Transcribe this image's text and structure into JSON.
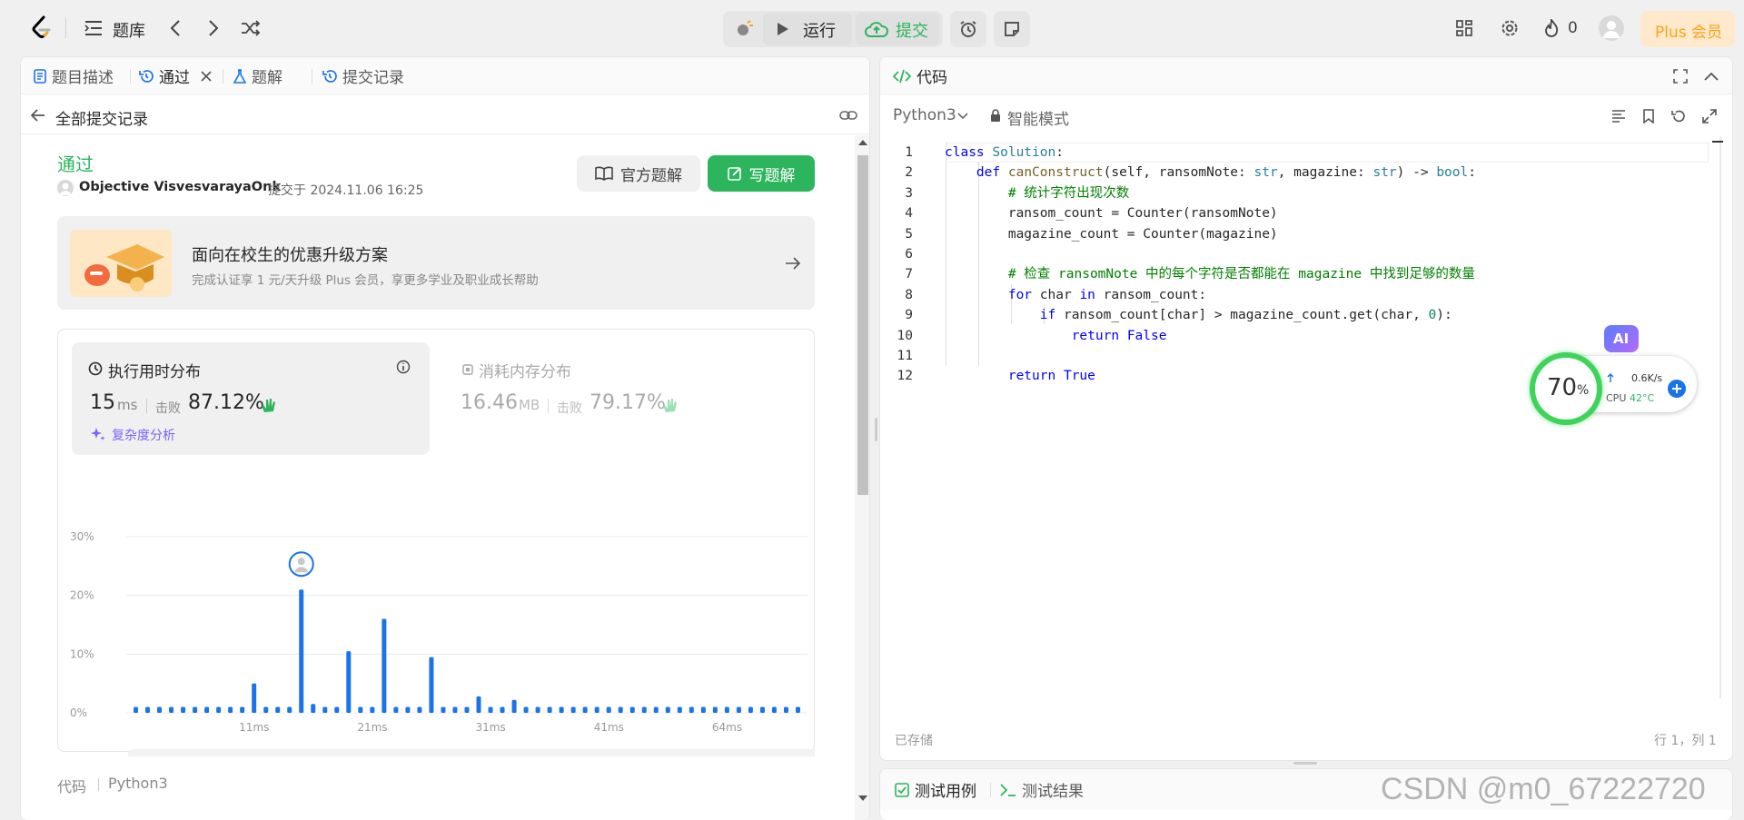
{
  "topbar": {
    "problems_label": "题库",
    "run_label": "运行",
    "submit_label": "提交",
    "streak_count": "0",
    "plus_label": "Plus 会员"
  },
  "left": {
    "tabs": [
      {
        "label": "题目描述"
      },
      {
        "label": "通过"
      },
      {
        "label": "题解"
      },
      {
        "label": "提交记录"
      }
    ],
    "back_label": "全部提交记录",
    "status": "通过",
    "username": "Objective VisvesvarayaOnk",
    "submitted_text": "提交于 2024.11.06 16:25",
    "official_solution_label": "官方题解",
    "write_solution_label": "写题解",
    "promo_title": "面向在校生的优惠升级方案",
    "promo_desc": "完成认证享 1 元/天升级 Plus 会员，享更多学业及职业成长帮助",
    "runtime_title": "执行用时分布",
    "runtime_value": "15",
    "runtime_unit": "ms",
    "beat_label": "击败",
    "runtime_beat": "87.12%",
    "complexity_label": "复杂度分析",
    "memory_title": "消耗内存分布",
    "memory_value": "16.46",
    "memory_unit": "MB",
    "memory_beat": "79.17%",
    "code_label": "代码",
    "code_lang": "Python3"
  },
  "chart_data": {
    "type": "bar",
    "y_ticks": [
      "30%",
      "20%",
      "10%",
      "0%"
    ],
    "ylim": [
      0,
      30
    ],
    "x_tick_labels": [
      "11ms",
      "21ms",
      "31ms",
      "41ms",
      "64ms"
    ],
    "values": [
      1,
      1,
      1,
      1,
      1,
      1,
      1,
      1,
      1,
      1,
      5,
      1,
      1,
      1,
      21,
      1.5,
      1,
      1,
      10.5,
      1,
      1,
      16,
      1,
      1,
      1,
      9.5,
      1,
      1,
      1,
      2.8,
      1,
      1,
      2.2,
      1,
      1,
      1,
      1,
      1,
      1,
      1,
      1,
      1,
      1,
      1,
      1,
      1,
      1,
      1,
      1,
      1,
      1,
      1,
      1,
      1,
      1,
      1,
      1
    ],
    "highlight_index": 14,
    "colors": {
      "bar": "#1a73e8",
      "mini": "#d9d9d9"
    }
  },
  "right": {
    "title": "代码",
    "lang": "Python3",
    "mode": "智能模式",
    "saved": "已存储",
    "cursor": "行 1，列 1",
    "lines": [
      "1",
      "2",
      "3",
      "4",
      "5",
      "6",
      "7",
      "8",
      "9",
      "10",
      "11",
      "12"
    ],
    "test_case_label": "测试用例",
    "test_result_label": "测试结果"
  },
  "widget": {
    "percent": "70",
    "percent_sign": "%",
    "net": "0.6K/s",
    "cpu_label": "CPU",
    "cpu_temp": "42°C",
    "ai": "AI"
  },
  "watermark": "CSDN @m0_67222720"
}
